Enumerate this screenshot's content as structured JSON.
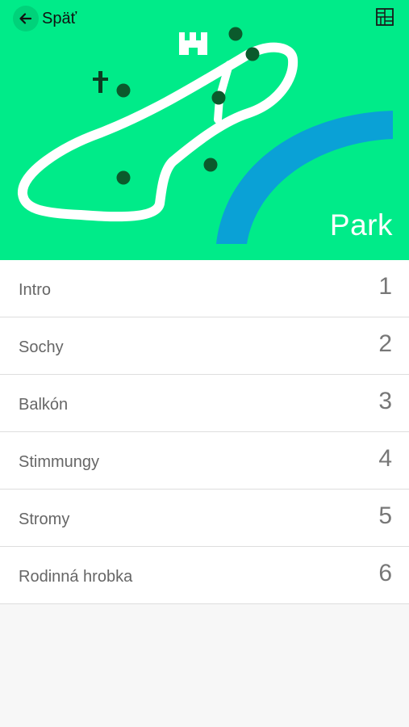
{
  "header": {
    "back_label": "Späť",
    "title": "Park",
    "icons": {
      "back": "arrow-left-icon",
      "map_toggle": "map-grid-icon"
    },
    "colors": {
      "background": "#00eb89",
      "path": "#ffffff",
      "river": "#0aa1d6",
      "markers": "#0b5a2c"
    }
  },
  "stops": [
    {
      "label": "Intro",
      "number": "1"
    },
    {
      "label": "Sochy",
      "number": "2"
    },
    {
      "label": "Balkón",
      "number": "3"
    },
    {
      "label": "Stimmungy",
      "number": "4"
    },
    {
      "label": "Stromy",
      "number": "5"
    },
    {
      "label": "Rodinná hrobka",
      "number": "6"
    }
  ]
}
